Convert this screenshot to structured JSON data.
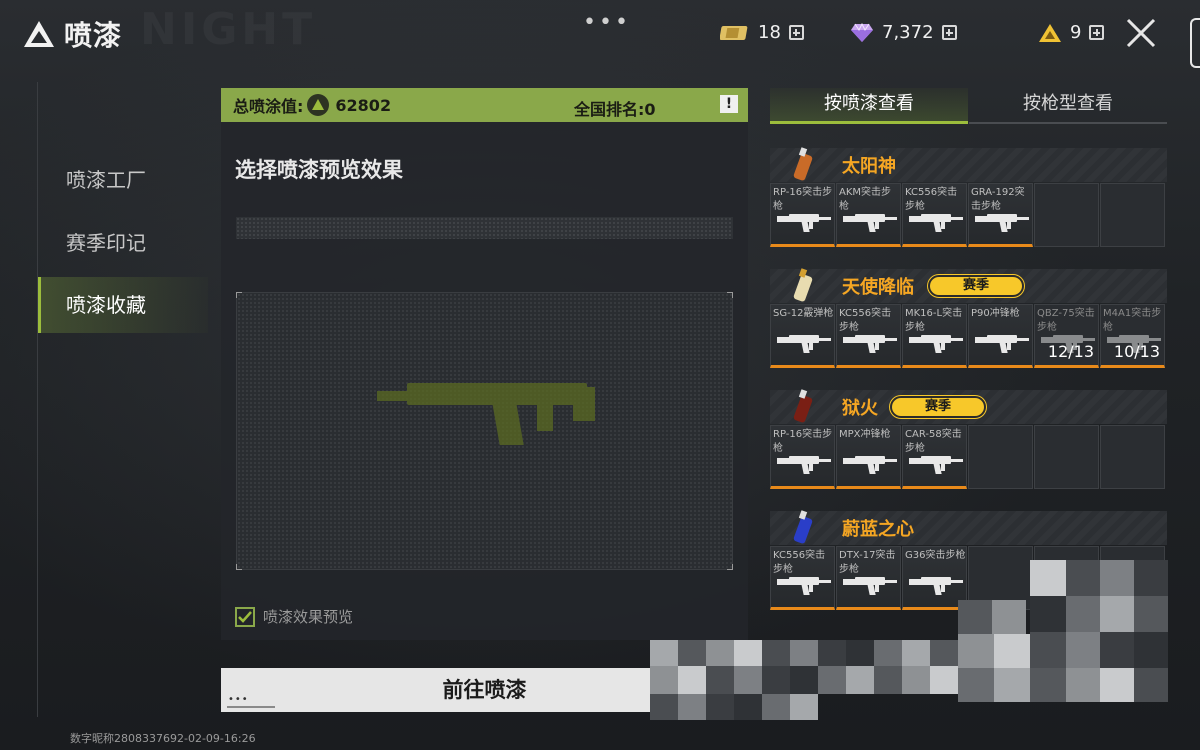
{
  "app": {
    "title": "喷漆"
  },
  "topbar": {
    "currencies": [
      {
        "name": "ticket",
        "icon": "ticket-icon",
        "value": "18"
      },
      {
        "name": "diamond",
        "icon": "diamond-icon",
        "value": "7,372"
      },
      {
        "name": "triangle",
        "icon": "triangle-coin-icon",
        "value": "9"
      }
    ]
  },
  "nav": {
    "items": [
      "喷漆工厂",
      "赛季印记",
      "喷漆收藏"
    ],
    "active": "喷漆收藏"
  },
  "score": {
    "label": "总喷涂值:",
    "value": "62802",
    "rank_label": "全国排名:0"
  },
  "center": {
    "title": "选择喷漆预览效果",
    "checkbox_label": "喷漆效果预览",
    "checkbox_checked": true,
    "go_button": "前往喷漆",
    "footer": "数字昵称2808337692-02-09-16:26"
  },
  "tabs": [
    "按喷漆查看",
    "按枪型查看"
  ],
  "groups": [
    {
      "name": "太阳神",
      "season_badge": "",
      "cells": [
        {
          "label": "RP-16突击步枪",
          "filled": true,
          "progress": ""
        },
        {
          "label": "AKM突击步枪",
          "filled": true,
          "progress": ""
        },
        {
          "label": "KC556突击步枪",
          "filled": true,
          "progress": ""
        },
        {
          "label": "GRA-192突击步枪",
          "filled": true,
          "progress": ""
        },
        {
          "label": "",
          "filled": false,
          "progress": ""
        },
        {
          "label": "",
          "filled": false,
          "progress": ""
        }
      ]
    },
    {
      "name": "天使降临",
      "season_badge": "赛季",
      "cells": [
        {
          "label": "SG-12霰弹枪",
          "filled": true,
          "progress": ""
        },
        {
          "label": "KC556突击步枪",
          "filled": true,
          "progress": ""
        },
        {
          "label": "MK16-L突击步枪",
          "filled": true,
          "progress": ""
        },
        {
          "label": "P90冲锋枪",
          "filled": true,
          "progress": ""
        },
        {
          "label": "QBZ-75突击步枪",
          "filled": false,
          "locked": true,
          "progress": "12/13"
        },
        {
          "label": "M4A1突击步枪",
          "filled": false,
          "locked": true,
          "progress": "10/13"
        }
      ]
    },
    {
      "name": "狱火",
      "season_badge": "赛季",
      "cells": [
        {
          "label": "RP-16突击步枪",
          "filled": true,
          "progress": ""
        },
        {
          "label": "MPX冲锋枪",
          "filled": true,
          "progress": ""
        },
        {
          "label": "CAR-58突击步枪",
          "filled": true,
          "progress": ""
        },
        {
          "label": "",
          "filled": false,
          "progress": ""
        },
        {
          "label": "",
          "filled": false,
          "progress": ""
        },
        {
          "label": "",
          "filled": false,
          "progress": ""
        }
      ]
    },
    {
      "name": "蔚蓝之心",
      "season_badge": "",
      "cells": [
        {
          "label": "KC556突击步枪",
          "filled": true,
          "progress": ""
        },
        {
          "label": "DTX-17突击步枪",
          "filled": true,
          "progress": ""
        },
        {
          "label": "G36突击步枪",
          "filled": true,
          "progress": ""
        },
        {
          "label": "",
          "filled": false,
          "progress": ""
        },
        {
          "label": "",
          "filled": false,
          "progress": ""
        },
        {
          "label": "",
          "filled": false,
          "progress": ""
        }
      ]
    }
  ],
  "colors": {
    "accent_green": "#8aa84a",
    "orange_text": "#f5a623",
    "orange_line": "#e88a1a",
    "season_yellow": "#f7c82a"
  }
}
